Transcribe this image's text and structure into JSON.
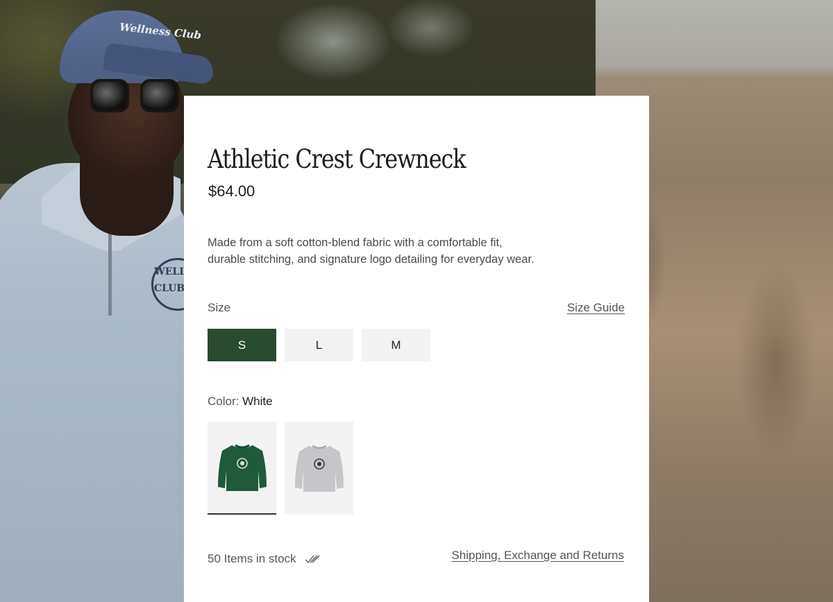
{
  "background": {
    "cap_text": "Wellness Club",
    "sweater_print": "WELLNESS CLUB"
  },
  "product": {
    "title": "Athletic Crest Crewneck",
    "price": "$64.00",
    "description_lines": [
      "Made from a soft cotton-blend fabric with a comfortable fit,",
      " durable stitching, and signature logo detailing for everyday wear."
    ]
  },
  "size": {
    "label": "Size",
    "guide_label": "Size Guide",
    "options": [
      "S",
      "L",
      "M"
    ],
    "selected": "S"
  },
  "color": {
    "label": "Color:",
    "selected_value": "White",
    "swatches": [
      {
        "name": "green",
        "hex": "#2b5a3c",
        "selected": true
      },
      {
        "name": "grey",
        "hex": "#c9c9cc",
        "selected": false
      }
    ]
  },
  "stock": {
    "text": "50 Items in stock",
    "icon": "double-check-icon"
  },
  "links": {
    "shipping": "Shipping, Exchange and Returns"
  },
  "colors": {
    "accent": "#2b4b31",
    "panel_bg": "#ffffff",
    "option_bg": "#f3f3f3"
  }
}
